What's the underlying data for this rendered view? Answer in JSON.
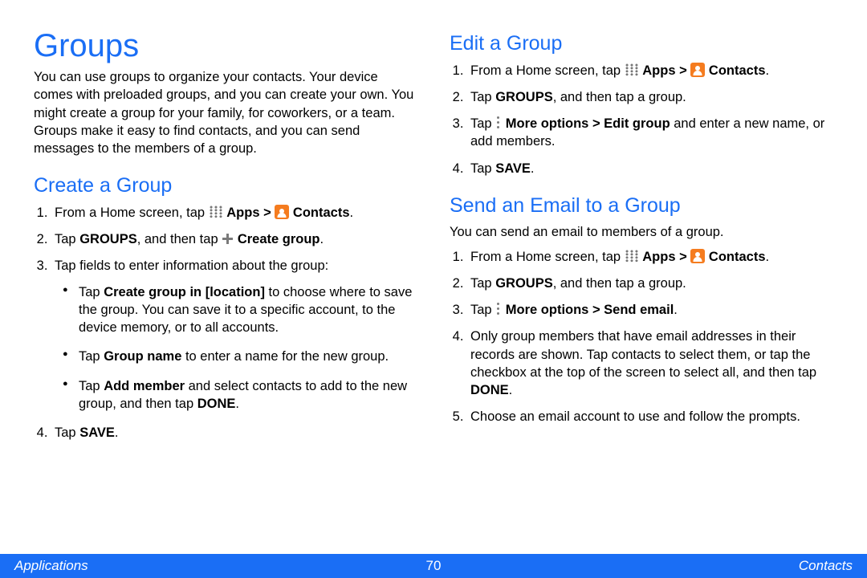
{
  "left": {
    "h1": "Groups",
    "intro": "You can use groups to organize your contacts. Your device comes with preloaded groups, and you can create your own. You might create a group for your family, for coworkers, or a team. Groups make it easy to find contacts, and you can send messages to the members of a group.",
    "h2": "Create a Group",
    "step1_a": "From a Home screen, tap ",
    "step1_apps": "Apps > ",
    "step1_contacts": "Contacts",
    "step1_end": ".",
    "step2_a": "Tap ",
    "step2_b": "GROUPS",
    "step2_c": ", and then tap ",
    "step2_d": "Create group",
    "step2_e": ".",
    "step3": "Tap fields to enter information about the group:",
    "b1_a": "Tap ",
    "b1_b": "Create group in [location]",
    "b1_c": " to choose where to save the group. You can save it to a specific account, to the device memory, or to all accounts.",
    "b2_a": "Tap ",
    "b2_b": "Group name",
    "b2_c": " to enter a name for the new group.",
    "b3_a": "Tap ",
    "b3_b": "Add member",
    "b3_c": " and select contacts to add to the new group, and then tap ",
    "b3_d": "DONE",
    "b3_e": ".",
    "step4_a": "Tap ",
    "step4_b": "SAVE",
    "step4_c": "."
  },
  "right": {
    "h2a": "Edit a Group",
    "a1_a": "From a Home screen, tap ",
    "a1_apps": "Apps > ",
    "a1_contacts": "Contacts",
    "a1_end": ".",
    "a2_a": "Tap ",
    "a2_b": "GROUPS",
    "a2_c": ", and then tap a group.",
    "a3_a": "Tap ",
    "a3_b": "More options > Edit group",
    "a3_c": " and enter a new name, or add members.",
    "a4_a": "Tap ",
    "a4_b": "SAVE",
    "a4_c": ".",
    "h2b": "Send an Email to a Group",
    "bintro": "You can send an email to members of a group.",
    "b1_a": "From a Home screen, tap ",
    "b1_apps": "Apps > ",
    "b1_contacts": "Contacts",
    "b1_end": ".",
    "b2_a": "Tap ",
    "b2_b": "GROUPS",
    "b2_c": ", and then tap a group.",
    "b3_a": "Tap ",
    "b3_b": "More options > Send email",
    "b3_c": ".",
    "b4_a": "Only group members that have email addresses in their records are shown. Tap contacts to select them, or tap the checkbox at the top of the screen to select all, and then tap ",
    "b4_b": "DONE",
    "b4_c": ".",
    "b5": "Choose an email account to use and follow the prompts."
  },
  "footer": {
    "left": "Applications",
    "center": "70",
    "right": "Contacts"
  }
}
